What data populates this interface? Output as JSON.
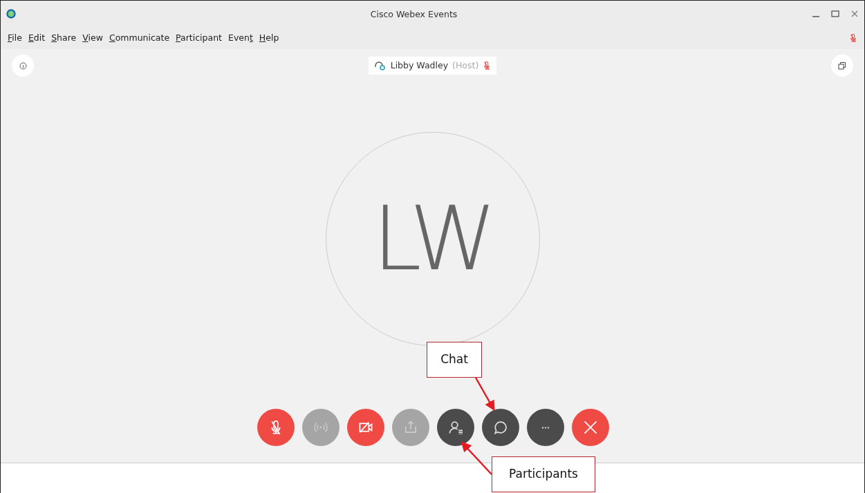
{
  "window": {
    "title": "Cisco Webex Events"
  },
  "menu": [
    {
      "key": "F",
      "rest": "ile"
    },
    {
      "key": "E",
      "rest": "dit"
    },
    {
      "key": "S",
      "rest": "hare"
    },
    {
      "key": "V",
      "rest": "iew"
    },
    {
      "key": "C",
      "rest": "ommunicate"
    },
    {
      "key": "P",
      "rest": "articipant"
    },
    {
      "lead": "Even",
      "key": "t"
    },
    {
      "key": "H",
      "rest": "elp"
    }
  ],
  "speaker": {
    "name": "Libby Wadley",
    "role": "(Host)",
    "muted": true
  },
  "avatar": {
    "initials": "LW"
  },
  "controls": [
    {
      "kind": "mute"
    },
    {
      "kind": "audio"
    },
    {
      "kind": "video"
    },
    {
      "kind": "share"
    },
    {
      "kind": "participants"
    },
    {
      "kind": "chat"
    },
    {
      "kind": "more"
    },
    {
      "kind": "leave"
    }
  ],
  "callouts": [
    {
      "label": "Chat"
    },
    {
      "label": "Participants"
    }
  ]
}
